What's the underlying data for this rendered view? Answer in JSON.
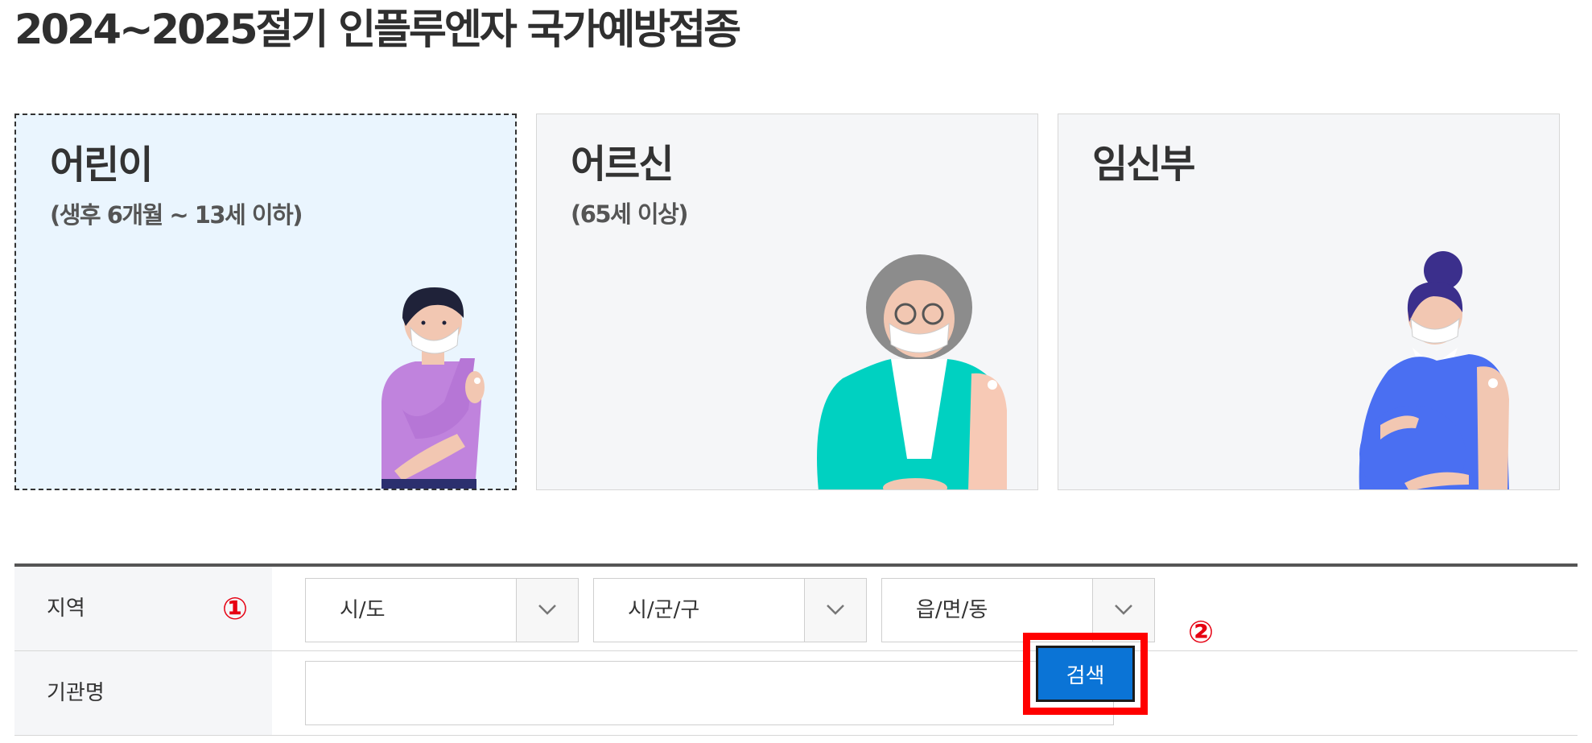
{
  "page": {
    "title": "2024~2025절기 인플루엔자 국가예방접종"
  },
  "target_groups": [
    {
      "title": "어린이",
      "subtitle": "(생후 6개월 ~ 13세 이하)",
      "selected": true,
      "illustration": "child-vaccination-illustration"
    },
    {
      "title": "어르신",
      "subtitle": "(65세 이상)",
      "selected": false,
      "illustration": "elderly-vaccination-illustration"
    },
    {
      "title": "임신부",
      "subtitle": "",
      "selected": false,
      "illustration": "pregnant-vaccination-illustration"
    }
  ],
  "search": {
    "region_label": "지역",
    "region_marker": "①",
    "sido_value": "시/도",
    "sigungu_value": "시/군/구",
    "dong_value": "읍/면/동",
    "institution_label": "기관명",
    "institution_value": "",
    "button_marker": "②",
    "button_label": "검색"
  },
  "colors": {
    "selected_card_bg": "#eaf5fe",
    "card_bg": "#f5f6f8",
    "button_bg": "#0b74d6",
    "marker": "#e60012",
    "highlight_border": "#ff0000"
  },
  "icons": [
    "chevron-down-icon"
  ]
}
